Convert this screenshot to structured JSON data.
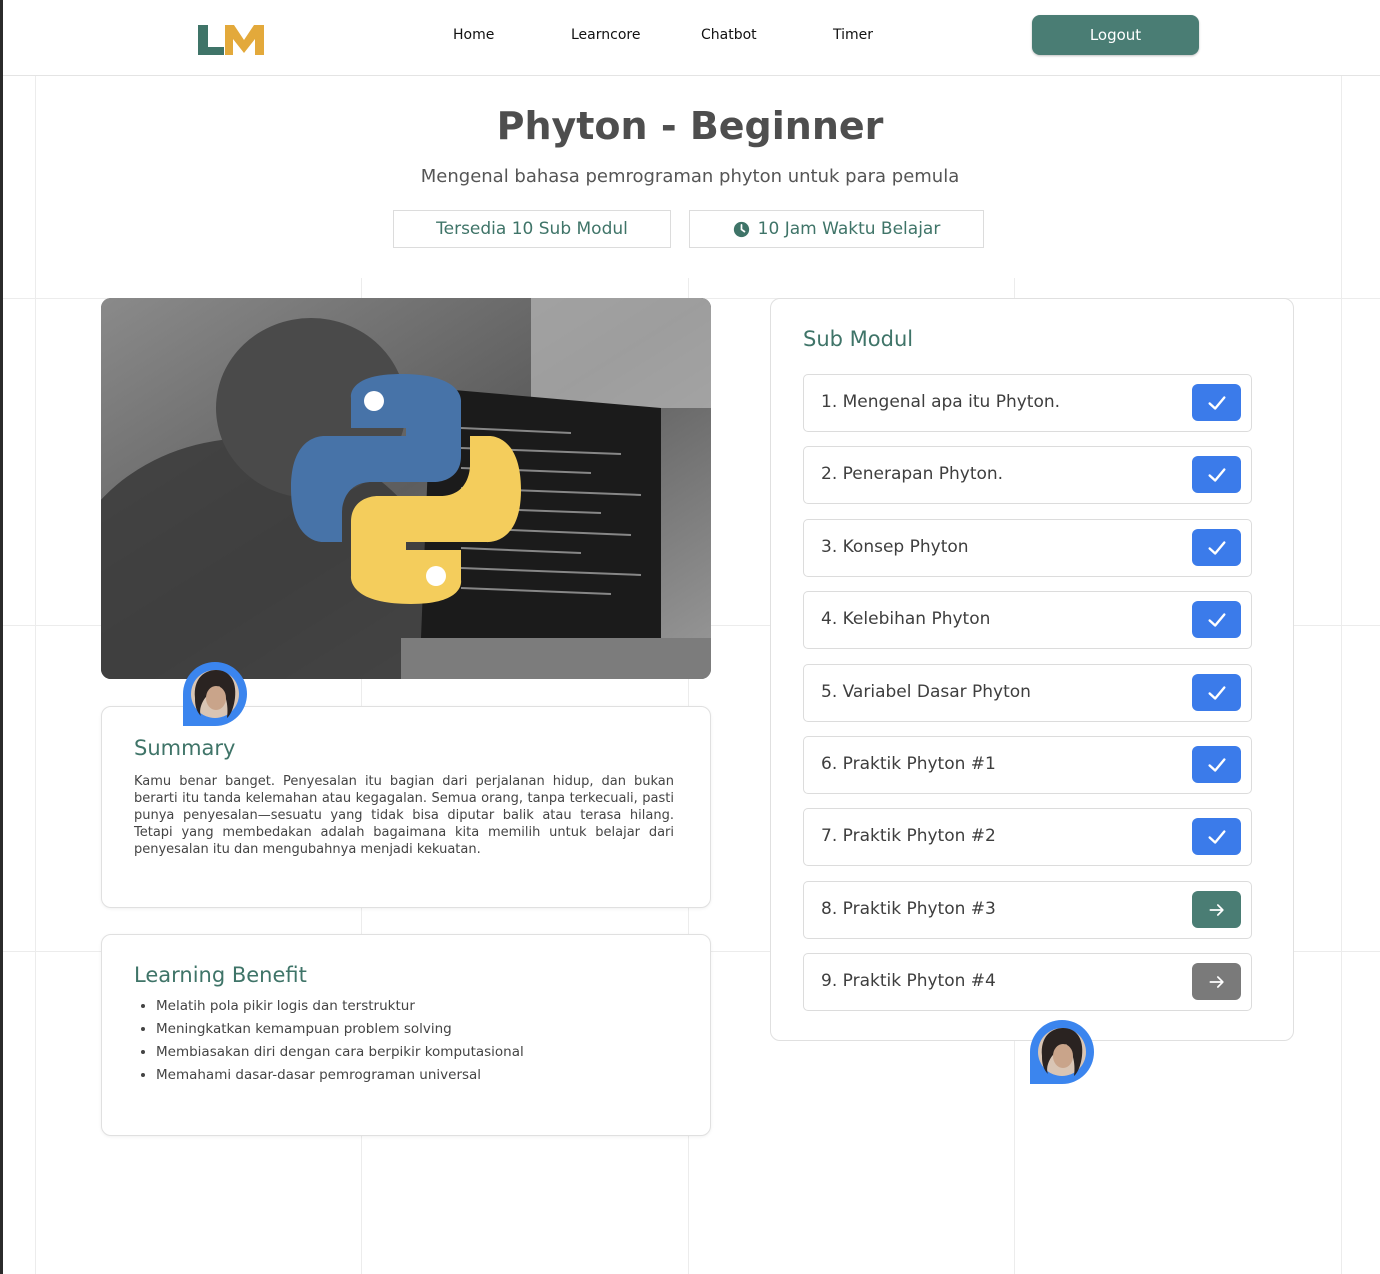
{
  "nav": {
    "logo_text": "LM",
    "links": [
      "Home",
      "Learncore",
      "Chatbot",
      "Timer"
    ],
    "logout_label": "Logout"
  },
  "course": {
    "title": "Phyton - Beginner",
    "subtitle": "Mengenal bahasa pemrograman phyton untuk para pemula",
    "modules_badge": "Tersedia 10 Sub Modul",
    "time_badge": "10 Jam Waktu Belajar"
  },
  "summary": {
    "heading": "Summary",
    "text": "Kamu benar banget. Penyesalan itu bagian dari perjalanan hidup, dan bukan berarti itu tanda kelemahan atau kegagalan. Semua orang, tanpa terkecuali, pasti punya penyesalan—sesuatu yang tidak bisa diputar balik atau terasa hilang. Tetapi yang membedakan adalah bagaimana kita memilih untuk belajar dari penyesalan itu dan mengubahnya menjadi kekuatan."
  },
  "benefit": {
    "heading": "Learning Benefit",
    "items": [
      "Melatih pola pikir logis dan terstruktur",
      "Meningkatkan kemampuan problem solving",
      "Membiasakan diri dengan cara berpikir komputasional",
      "Memahami dasar-dasar pemrograman universal"
    ]
  },
  "sub_modul": {
    "heading": "Sub Modul",
    "items": [
      {
        "label": "1. Mengenal apa itu Phyton.",
        "status": "done"
      },
      {
        "label": "2. Penerapan Phyton.",
        "status": "done"
      },
      {
        "label": "3. Konsep Phyton",
        "status": "done"
      },
      {
        "label": "4. Kelebihan Phyton",
        "status": "done"
      },
      {
        "label": "5. Variabel Dasar Phyton",
        "status": "done"
      },
      {
        "label": "6. Praktik Phyton #1",
        "status": "done"
      },
      {
        "label": "7. Praktik Phyton #2",
        "status": "done"
      },
      {
        "label": "8. Praktik Phyton #3",
        "status": "next"
      },
      {
        "label": "9. Praktik Phyton #4",
        "status": "locked"
      }
    ]
  },
  "colors": {
    "accent_green": "#4a7d74",
    "done_blue": "#3b7bea",
    "locked_gray": "#7a7a7a",
    "logo_green": "#3f7468",
    "logo_gold": "#e3a93b"
  },
  "icons": {
    "done": "check-icon",
    "next": "arrow-right-icon",
    "locked": "arrow-right-icon",
    "time": "clock-icon"
  }
}
